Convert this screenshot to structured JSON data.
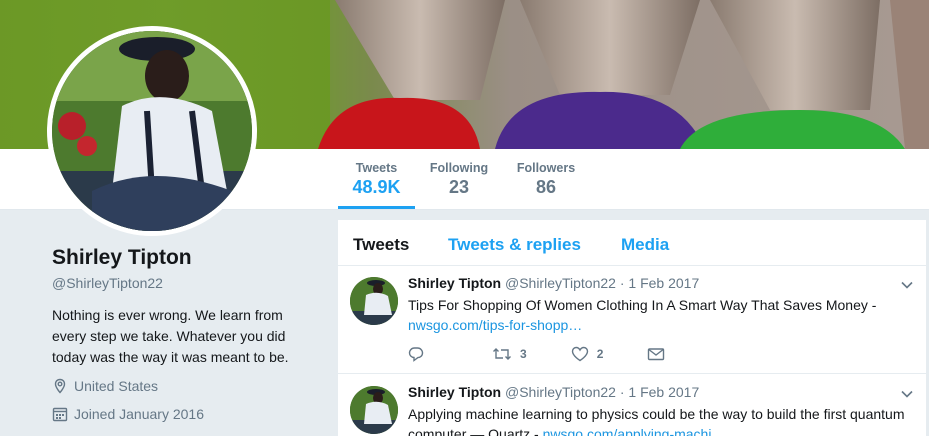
{
  "profile": {
    "name": "Shirley Tipton",
    "handle": "@ShirleyTipton22",
    "bio": "Nothing is ever wrong. We learn from every step we take. Whatever you did today was the way it was meant to be.",
    "location": "United States",
    "joined": "Joined January 2016"
  },
  "stats": {
    "tweets_label": "Tweets",
    "tweets_value": "48.9K",
    "following_label": "Following",
    "following_value": "23",
    "followers_label": "Followers",
    "followers_value": "86"
  },
  "tabs": {
    "tweets": "Tweets",
    "replies": "Tweets & replies",
    "media": "Media"
  },
  "tweets": [
    {
      "name": "Shirley Tipton",
      "handle": "@ShirleyTipton22",
      "date": "· 1 Feb 2017",
      "text": "Tips For Shopping Of Women Clothing In A Smart Way That Saves Money -",
      "link": "nwsgo.com/tips-for-shopp…",
      "retweets": "3",
      "likes": "2"
    },
    {
      "name": "Shirley Tipton",
      "handle": "@ShirleyTipton22",
      "date": "· 1 Feb 2017",
      "text": "Applying machine learning to physics could be the way to build the first quantum computer — Quartz -",
      "link": "nwsgo.com/applying-machi…"
    }
  ],
  "colors": {
    "accent": "#1da1f2",
    "link": "#1b95e0",
    "muted": "#657786",
    "text": "#14171a"
  },
  "icons": [
    "location-icon",
    "calendar-icon",
    "chevron-down-icon",
    "reply-icon",
    "retweet-icon",
    "like-icon",
    "message-icon"
  ]
}
